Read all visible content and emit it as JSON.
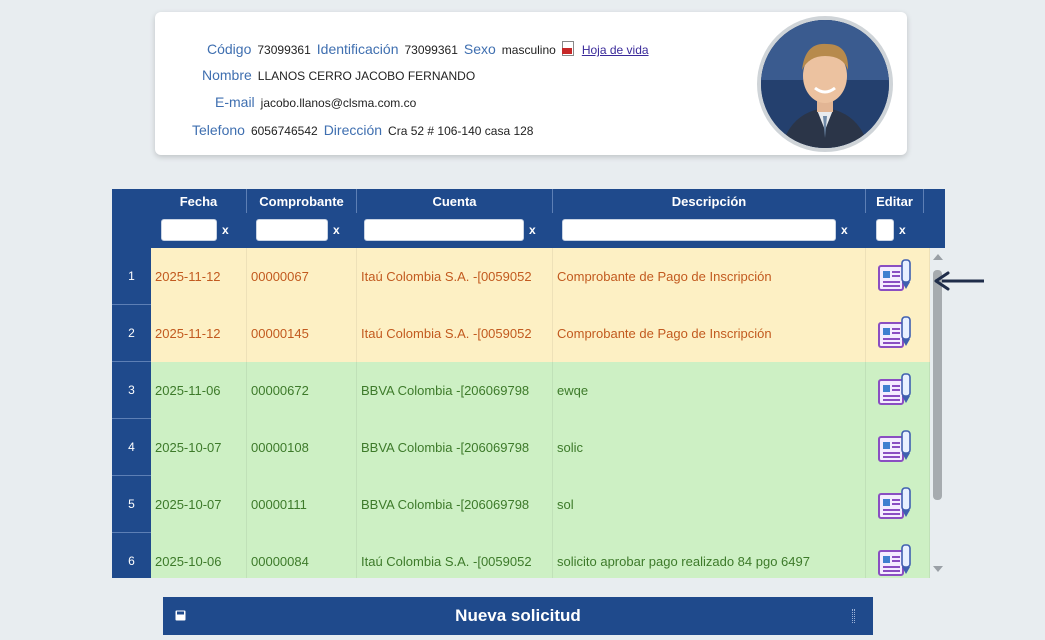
{
  "profile": {
    "codigo_label": "Código",
    "codigo": "73099361",
    "identificacion_label": "Identificación",
    "identificacion": "73099361",
    "sexo_label": "Sexo",
    "sexo": "masculino",
    "cv_link": "Hoja de vida",
    "nombre_label": "Nombre",
    "nombre": "LLANOS CERRO JACOBO FERNANDO",
    "email_label": "E-mail",
    "email": "jacobo.llanos@clsma.com.co",
    "telefono_label": "Telefono",
    "telefono": "6056746542",
    "direccion_label": "Dirección",
    "direccion": "Cra 52 # 106-140 casa 128"
  },
  "grid": {
    "headers": [
      "Fecha",
      "Comprobante",
      "Cuenta",
      "Descripción",
      "Editar"
    ],
    "filter_clear": "x",
    "rows": [
      {
        "n": "1",
        "fecha": "2025-11-12",
        "comprobante": "00000067",
        "cuenta": "Itaú Colombia S.A.  -[0059052",
        "descripcion": "Comprobante de Pago de Inscripción",
        "status": "pend"
      },
      {
        "n": "2",
        "fecha": "2025-11-12",
        "comprobante": "00000145",
        "cuenta": "Itaú Colombia S.A.  -[0059052",
        "descripcion": "Comprobante de Pago de Inscripción",
        "status": "pend"
      },
      {
        "n": "3",
        "fecha": "2025-11-06",
        "comprobante": "00000672",
        "cuenta": "BBVA Colombia  -[206069798",
        "descripcion": "ewqe",
        "status": "ok"
      },
      {
        "n": "4",
        "fecha": "2025-10-07",
        "comprobante": "00000108",
        "cuenta": "BBVA Colombia  -[206069798",
        "descripcion": "solic",
        "status": "ok"
      },
      {
        "n": "5",
        "fecha": "2025-10-07",
        "comprobante": "00000111",
        "cuenta": "BBVA Colombia  -[206069798",
        "descripcion": "sol",
        "status": "ok"
      },
      {
        "n": "6",
        "fecha": "2025-10-06",
        "comprobante": "00000084",
        "cuenta": "Itaú Colombia S.A.  -[0059052",
        "descripcion": "solicito aprobar pago realizado 84 pgo 6497",
        "status": "ok"
      }
    ]
  },
  "actions": {
    "new_request": "Nueva solicitud"
  },
  "colors": {
    "header_bg": "#1f4a8c",
    "pending_row": "#fdf0c4",
    "approved_row": "#cdf0c4"
  }
}
